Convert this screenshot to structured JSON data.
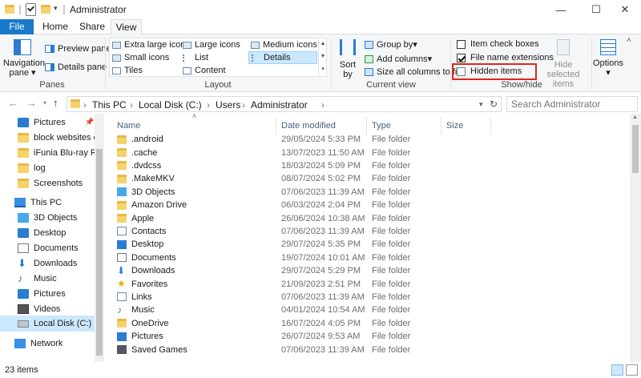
{
  "window": {
    "title": "Administrator",
    "minimize_glyph": "—",
    "maximize_glyph": "☐",
    "close_glyph": "✕"
  },
  "tabs": [
    "File",
    "Home",
    "Share",
    "View"
  ],
  "ribbon": {
    "panes": {
      "label": "Panes",
      "navigation_pane": "Navigation pane",
      "preview_pane": "Preview pane",
      "details_pane": "Details pane"
    },
    "layout": {
      "label": "Layout",
      "items": [
        "Extra large icons",
        "Large icons",
        "Medium icons",
        "Small icons",
        "List",
        "Details",
        "Tiles",
        "Content"
      ],
      "selected": "Details"
    },
    "current_view": {
      "label": "Current view",
      "sort_by": "Sort by",
      "group_by": "Group by",
      "add_columns": "Add columns",
      "size_all_columns": "Size all columns to fit"
    },
    "show_hide": {
      "label": "Show/hide",
      "item_check_boxes": "Item check boxes",
      "file_name_extensions": "File name extensions",
      "hidden_items": "Hidden items",
      "hide_selected": "Hide selected items",
      "item_check_boxes_checked": false,
      "file_name_extensions_checked": true,
      "hidden_items_checked": false
    },
    "options": "Options"
  },
  "address": {
    "crumbs": [
      "This PC",
      "Local Disk (C:)",
      "Users",
      "Administrator"
    ],
    "search_placeholder": "Search Administrator"
  },
  "nav": {
    "items": [
      "Pictures",
      "block websites on",
      "iFunia Blu-ray Ripp",
      "log",
      "Screenshots",
      "This PC",
      "3D Objects",
      "Desktop",
      "Documents",
      "Downloads",
      "Music",
      "Pictures",
      "Videos",
      "Local Disk (C:)",
      "Network"
    ],
    "selected": "Local Disk (C:)"
  },
  "columns": [
    "Name",
    "Date modified",
    "Type",
    "Size"
  ],
  "files": [
    {
      "name": ".android",
      "date": "29/05/2024 5:33 PM",
      "type": "File folder"
    },
    {
      "name": ".cache",
      "date": "13/07/2023 11:50 AM",
      "type": "File folder"
    },
    {
      "name": ".dvdcss",
      "date": "18/03/2024 5:09 PM",
      "type": "File folder"
    },
    {
      "name": ".MakeMKV",
      "date": "08/07/2024 5:02 PM",
      "type": "File folder"
    },
    {
      "name": "3D Objects",
      "date": "07/06/2023 11:39 AM",
      "type": "File folder"
    },
    {
      "name": "Amazon Drive",
      "date": "06/03/2024 2:04 PM",
      "type": "File folder"
    },
    {
      "name": "Apple",
      "date": "26/06/2024 10:38 AM",
      "type": "File folder"
    },
    {
      "name": "Contacts",
      "date": "07/06/2023 11:39 AM",
      "type": "File folder"
    },
    {
      "name": "Desktop",
      "date": "29/07/2024 5:35 PM",
      "type": "File folder"
    },
    {
      "name": "Documents",
      "date": "19/07/2024 10:01 AM",
      "type": "File folder"
    },
    {
      "name": "Downloads",
      "date": "29/07/2024 5:29 PM",
      "type": "File folder"
    },
    {
      "name": "Favorites",
      "date": "21/09/2023 2:51 PM",
      "type": "File folder"
    },
    {
      "name": "Links",
      "date": "07/06/2023 11:39 AM",
      "type": "File folder"
    },
    {
      "name": "Music",
      "date": "04/01/2024 10:54 AM",
      "type": "File folder"
    },
    {
      "name": "OneDrive",
      "date": "16/07/2024 4:05 PM",
      "type": "File folder"
    },
    {
      "name": "Pictures",
      "date": "26/07/2024 9:53 AM",
      "type": "File folder"
    },
    {
      "name": "Saved Games",
      "date": "07/06/2023 11:39 AM",
      "type": "File folder"
    }
  ],
  "status": {
    "count": "23 items"
  }
}
